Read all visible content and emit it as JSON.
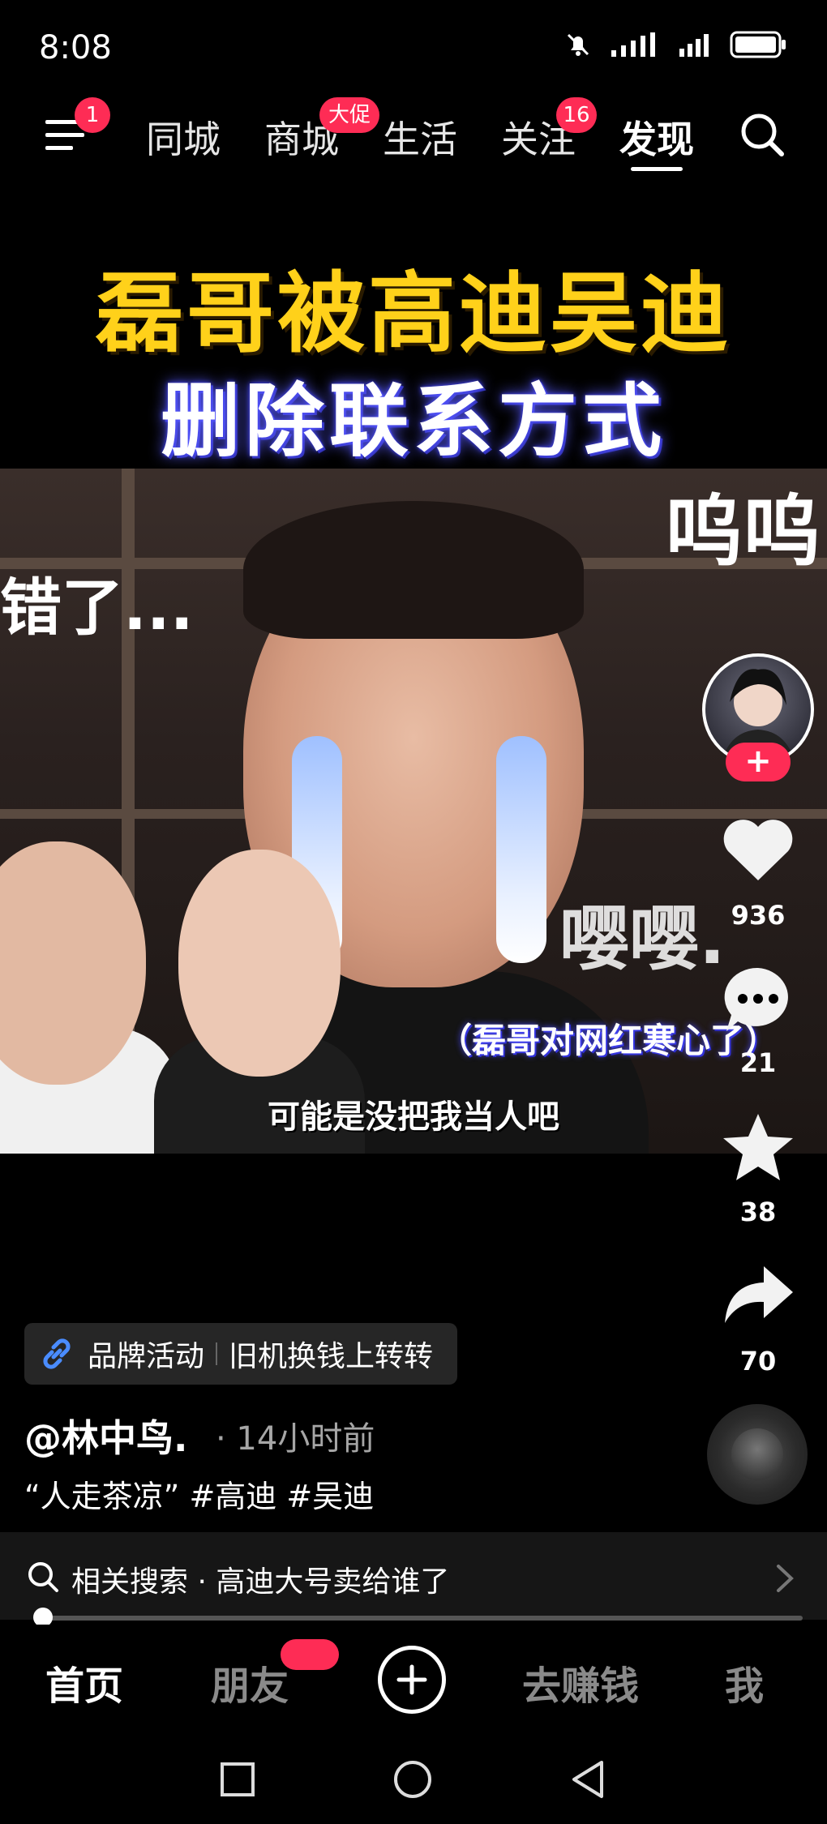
{
  "status_bar": {
    "time": "8:08"
  },
  "top_nav": {
    "menu_badge": "1",
    "tabs": [
      {
        "label": "同城"
      },
      {
        "label": "商城",
        "badge": "大促"
      },
      {
        "label": "生活"
      },
      {
        "label": "关注",
        "badge": "16"
      },
      {
        "label": "发现",
        "active": true
      }
    ]
  },
  "video": {
    "title_line1": "磊哥被高迪吴迪",
    "title_line2": "删除联系方式",
    "overlay_left": "错了...",
    "overlay_right": "呜呜",
    "overlay_mid": "嘤嘤.",
    "subtitle_blue": "（磊哥对网红寒心了）",
    "caption": "可能是没把我当人吧"
  },
  "right_rail": {
    "follow_label": "+",
    "likes": "936",
    "comments": "21",
    "favorites": "38",
    "shares": "70"
  },
  "promo": {
    "tag": "品牌活动",
    "text": "旧机换钱上转转"
  },
  "post": {
    "author": "@林中鸟.",
    "time_ago": "· 14小时前",
    "description": "“人走茶凉” #高迪 #吴迪"
  },
  "related_search": {
    "label": "相关搜索 · 高迪大号卖给谁了"
  },
  "playback": {
    "progress": 0.01
  },
  "bottom_tabs": [
    {
      "label": "首页",
      "active": true
    },
    {
      "label": "朋友"
    },
    {
      "label": "去赚钱"
    },
    {
      "label": "我"
    }
  ],
  "colors": {
    "accent": "#fe2c55",
    "title_yellow": "#ffd11a",
    "background": "#000000"
  }
}
